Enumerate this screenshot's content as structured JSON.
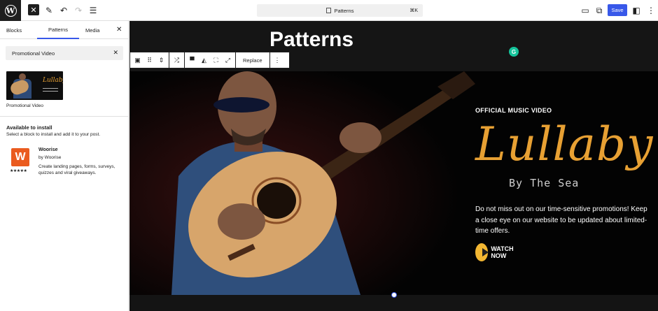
{
  "topbar": {
    "close_icon": "close-icon",
    "command_title": "Patterns",
    "command_shortcut": "⌘K",
    "save_label": "Save"
  },
  "sidebar": {
    "tabs": [
      {
        "label": "Blocks"
      },
      {
        "label": "Patterns",
        "active": true
      },
      {
        "label": "Media"
      }
    ],
    "search": {
      "value": "Promotional Video"
    },
    "pattern": {
      "label": "Promotional Video",
      "thumb_text": "Lullaby"
    },
    "available": {
      "title": "Available to install",
      "subtitle": "Select a block to install and add it to your post.",
      "plugin": {
        "logo_text": "W",
        "stars": "★★★★★",
        "name": "Woorise",
        "author": "by Woorise",
        "description": "Create landing pages, forms, surveys, quizzes and viral giveaways."
      }
    }
  },
  "canvas": {
    "heading": "Patterns",
    "grammarly": "G",
    "block_toolbar": {
      "replace_label": "Replace"
    },
    "hero": {
      "eyebrow": "OFFICIAL MUSIC VIDEO",
      "title": "Lullaby",
      "subtitle": "By The Sea",
      "description": "Do not miss out on our time-sensitive promotions! Keep a close eye on our website to be updated about limited-time offers.",
      "cta": "WATCH NOW"
    }
  },
  "colors": {
    "accent": "#3858e9",
    "gold": "#e7a033",
    "play": "#f2b632",
    "woorise": "#ea5b1f"
  }
}
